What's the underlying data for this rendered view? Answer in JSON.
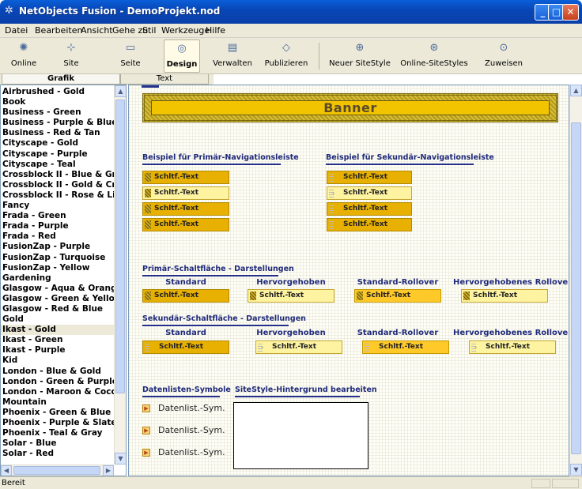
{
  "window": {
    "title": "NetObjects Fusion - DemoProjekt.nod",
    "minimize": "_",
    "maximize": "□",
    "close": "✕"
  },
  "menu": [
    "Datei",
    "Bearbeiten",
    "Ansicht",
    "Gehe zu",
    "Stil",
    "Werkzeuge",
    "Hilfe"
  ],
  "toolbar": {
    "online": "Online",
    "site": "Site",
    "seite": "Seite",
    "design": "Design",
    "verwalten": "Verwalten",
    "publizieren": "Publizieren",
    "neuer_sitestyle": "Neuer SiteStyle",
    "online_sitestyles": "Online-SiteStyles",
    "zuweisen": "Zuweisen"
  },
  "tabs": {
    "grafik": "Grafik",
    "text": "Text"
  },
  "style_list": [
    "Airbrushed - Gold",
    "Book",
    "Business - Green",
    "Business - Purple & Blue",
    "Business - Red & Tan",
    "Cityscape - Gold",
    "Cityscape - Purple",
    "Cityscape - Teal",
    "Crossblock II - Blue & Gree",
    "Crossblock II - Gold & Crim",
    "Crossblock II - Rose & Lila",
    "Fancy",
    "Frada - Green",
    "Frada - Purple",
    "Frada - Red",
    "FusionZap - Purple",
    "FusionZap - Turquoise",
    "FusionZap - Yellow",
    "Gardening",
    "Glasgow - Aqua & Orange",
    "Glasgow - Green & Yellow",
    "Glasgow - Red & Blue",
    "Gold",
    "Ikast - Gold",
    "Ikast - Green",
    "Ikast - Purple",
    "Kid",
    "London - Blue & Gold",
    "London - Green & Purple",
    "London - Maroon & Cocoa",
    "Mountain",
    "Phoenix - Green & Blue",
    "Phoenix - Purple & Slate",
    "Phoenix - Teal & Gray",
    "Solar - Blue",
    "Solar - Red"
  ],
  "selected_style": "Ikast - Gold",
  "preview": {
    "banner": "Banner",
    "primary_nav_heading": "Beispiel für Primär-Navigationsleiste",
    "secondary_nav_heading": "Beispiel für Sekundär-Navigationsleiste",
    "button_text": "Schltf.-Text",
    "primary_button_heading": "Primär-Schaltfläche - Darstellungen",
    "secondary_button_heading": "Sekundär-Schaltfläche - Darstellungen",
    "states": [
      "Standard",
      "Hervorgehoben",
      "Standard-Rollover",
      "Hervorgehobenes Rollover"
    ],
    "datalist_heading": "Datenlisten-Symbole",
    "background_heading": "SiteStyle-Hintergrund bearbeiten",
    "datalist_items": [
      "Datenlist.-Sym.",
      "Datenlist.-Sym.",
      "Datenlist.-Sym."
    ]
  },
  "status": "Bereit"
}
